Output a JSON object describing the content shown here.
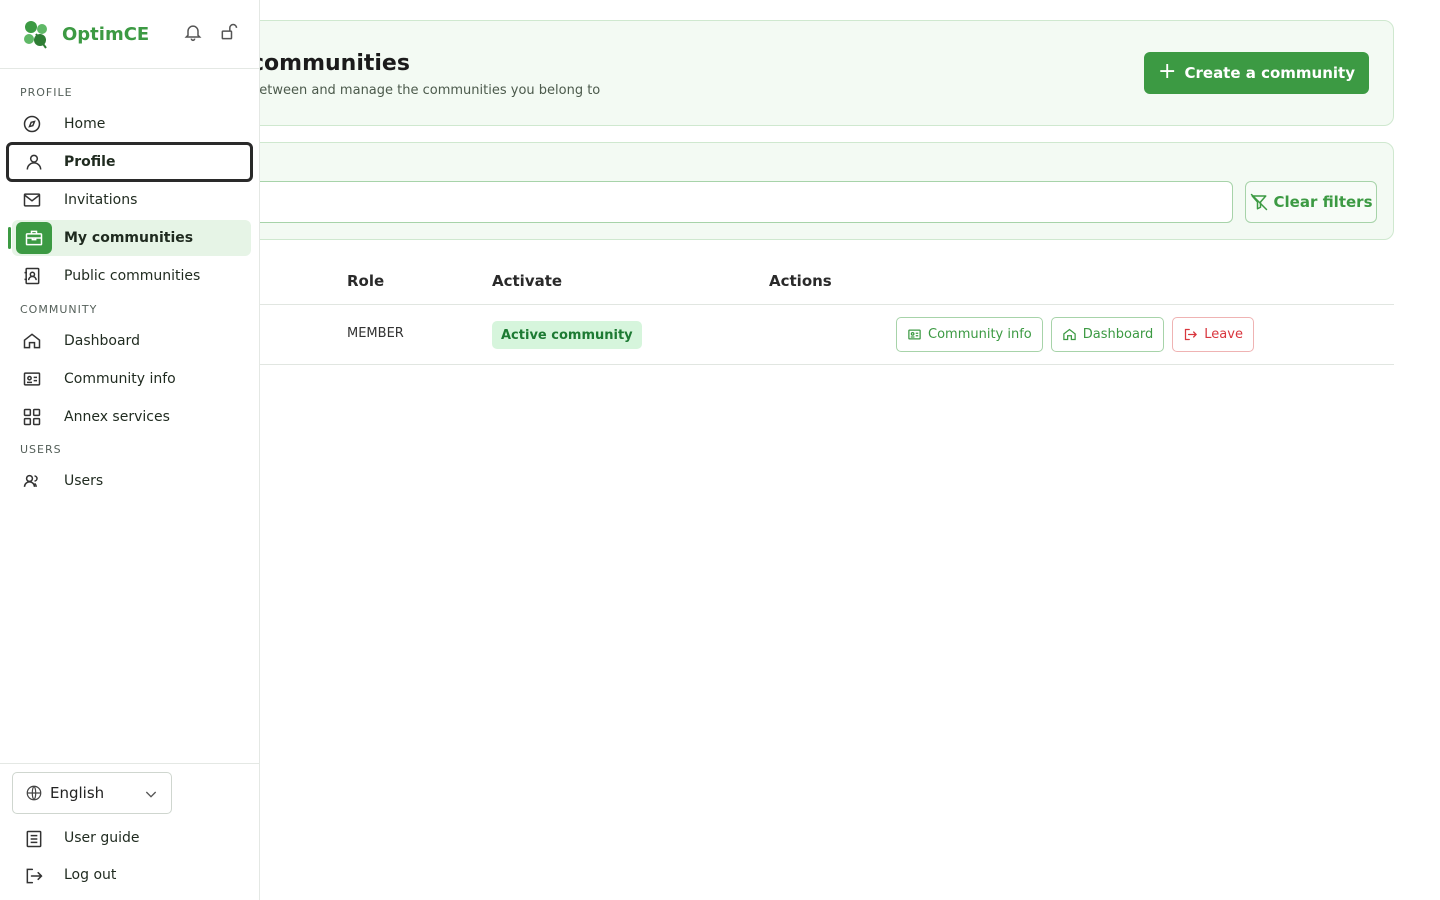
{
  "brand": {
    "name": "OptimCE",
    "color": "#3c9a43"
  },
  "page": {
    "title": "communities",
    "subtitle": "between and manage the communities you belong to",
    "create_button": "Create a community",
    "clear_filters": "Clear filters"
  },
  "table": {
    "headers": {
      "role": "Role",
      "activate": "Activate",
      "actions": "Actions"
    },
    "rows": [
      {
        "role": "MEMBER",
        "status": "Active community",
        "actions": {
          "info": "Community info",
          "dashboard": "Dashboard",
          "leave": "Leave"
        }
      }
    ]
  },
  "sidebar": {
    "sections": {
      "profile": "PROFILE",
      "community": "COMMUNITY",
      "users": "USERS"
    },
    "items": {
      "home": "Home",
      "profile": "Profile",
      "invitations": "Invitations",
      "my_communities": "My communities",
      "public_communities": "Public communities",
      "dashboard": "Dashboard",
      "community_info": "Community info",
      "annex_services": "Annex services",
      "users": "Users"
    },
    "language": "English",
    "user_guide": "User guide",
    "logout": "Log out"
  },
  "icons": {
    "notification": "bell-icon",
    "lock": "unlock-icon"
  },
  "colors": {
    "accent": "#3c9a43",
    "danger": "#d9363e",
    "badge_bg": "#d6f5dc"
  }
}
